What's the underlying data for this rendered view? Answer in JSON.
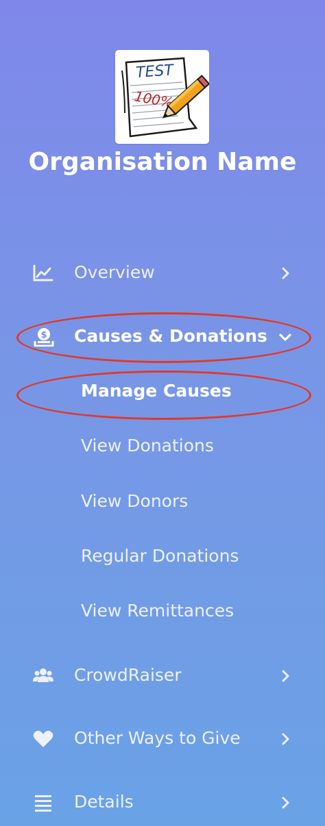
{
  "sidebar": {
    "logo": {
      "alt": "Organisation logo",
      "test_text": "TEST",
      "score_text": "100%"
    },
    "org_name": "Organisation Name",
    "nav": [
      {
        "label": "Overview",
        "icon": "chart-line-icon",
        "expanded": false
      },
      {
        "label": "Causes & Donations",
        "icon": "hand-donate-coin-icon",
        "expanded": true,
        "active": true
      },
      {
        "label": "CrowdRaiser",
        "icon": "users-group-icon",
        "expanded": false
      },
      {
        "label": "Other Ways to Give",
        "icon": "heart-icon",
        "expanded": false
      },
      {
        "label": "Details",
        "icon": "list-icon",
        "expanded": false
      }
    ],
    "submenu": [
      {
        "label": "Manage Causes",
        "active": true
      },
      {
        "label": "View Donations"
      },
      {
        "label": "View Donors"
      },
      {
        "label": "Regular Donations"
      },
      {
        "label": "View Remittances"
      }
    ]
  },
  "colors": {
    "gradient_top": "#7f88ea",
    "gradient_bottom": "#6aa2e6",
    "text": "#eef1fb",
    "active_text": "#ffffff",
    "annotation": "#e0392b"
  }
}
